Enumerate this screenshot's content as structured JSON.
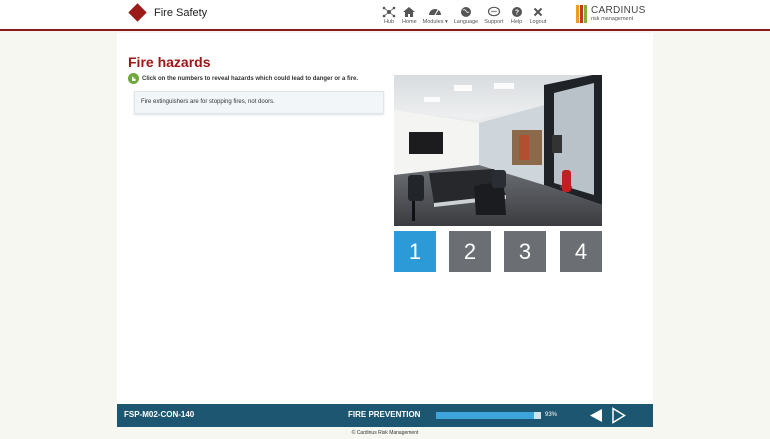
{
  "header": {
    "title": "Fire Safety",
    "nav": [
      {
        "label": "Hub",
        "icon": "hub-icon"
      },
      {
        "label": "Home",
        "icon": "home-icon"
      },
      {
        "label": "Modules ▾",
        "icon": "dashboard-icon"
      },
      {
        "label": "Language",
        "icon": "globe-icon"
      },
      {
        "label": "Support",
        "icon": "chat-icon"
      },
      {
        "label": "Help",
        "icon": "help-icon"
      },
      {
        "label": "Logout",
        "icon": "close-icon"
      }
    ],
    "logo": {
      "name": "CARDINUS",
      "sub": "risk management",
      "colors": [
        "#e8a020",
        "#c0392b",
        "#7fb23a"
      ]
    }
  },
  "main": {
    "title": "Fire hazards",
    "instruction": "Click on the numbers to reveal hazards which could lead to danger or a fire.",
    "hazard_text": "Fire extinguishers are for stopping fires, not doors.",
    "buttons": [
      {
        "label": "1",
        "active": true
      },
      {
        "label": "2",
        "active": false
      },
      {
        "label": "3",
        "active": false
      },
      {
        "label": "4",
        "active": false
      }
    ],
    "colors": {
      "active": "#2d9ad8",
      "inactive": "#6b6e72",
      "title": "#a01515"
    }
  },
  "footer": {
    "course_code": "FSP-M02-CON-140",
    "section": "FIRE PREVENTION",
    "progress": 93,
    "progress_label": "93%",
    "copyright": "Cardinus Risk Management"
  }
}
